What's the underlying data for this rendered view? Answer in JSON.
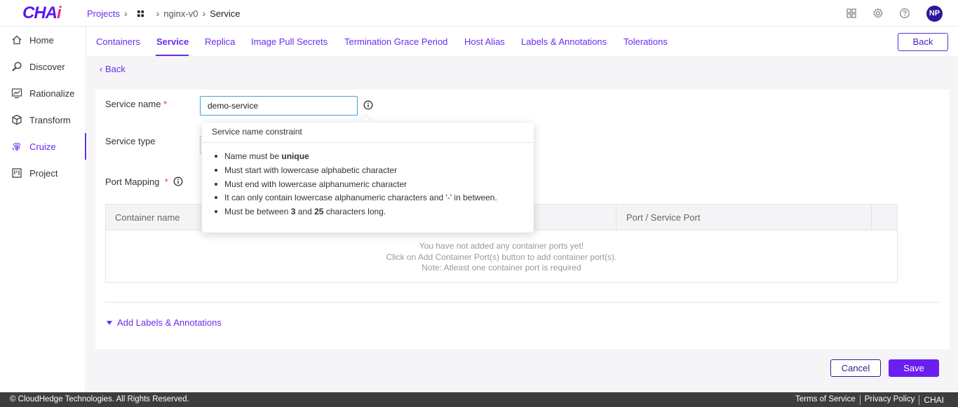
{
  "brand": {
    "logo_main": "CHA",
    "logo_accent": "i"
  },
  "breadcrumb": {
    "projects": "Projects",
    "project": "nginx-v0",
    "current": "Service"
  },
  "header": {
    "avatar": "NP"
  },
  "sidebar": {
    "items": [
      {
        "label": "Home",
        "icon": "home-icon"
      },
      {
        "label": "Discover",
        "icon": "search-icon"
      },
      {
        "label": "Rationalize",
        "icon": "chart-icon"
      },
      {
        "label": "Transform",
        "icon": "cube-icon"
      },
      {
        "label": "Cruize",
        "icon": "fingerprint-icon"
      },
      {
        "label": "Project",
        "icon": "board-icon"
      }
    ],
    "active": "Cruize"
  },
  "tabs": [
    {
      "label": "Containers"
    },
    {
      "label": "Service"
    },
    {
      "label": "Replica"
    },
    {
      "label": "Image Pull Secrets"
    },
    {
      "label": "Termination Grace Period"
    },
    {
      "label": "Host Alias"
    },
    {
      "label": "Labels & Annotations"
    },
    {
      "label": "Tolerations"
    }
  ],
  "active_tab": "Service",
  "top_back_label": "Back",
  "back_link": "Back",
  "form": {
    "service_name_label": "Service name",
    "service_name_value": "demo-service",
    "service_type_label": "Service type",
    "port_mapping_label": "Port Mapping",
    "required_mark": "*"
  },
  "table": {
    "columns": [
      "Container name",
      "Port / Service Port"
    ],
    "empty_line1": "You have not added any container ports yet!",
    "empty_line2": "Click on Add Container Port(s) button to add container port(s).",
    "empty_line3": "Note: Atleast one container port is required"
  },
  "add_labels": "Add Labels & Annotations",
  "buttons": {
    "cancel": "Cancel",
    "save": "Save"
  },
  "tooltip": {
    "title": "Service name constraint",
    "r1_pre": "Name must be ",
    "r1_bold": "unique",
    "r2": "Must start with lowercase alphabetic character",
    "r3": "Must end with lowercase alphanumeric character",
    "r4": "It can only contain lowercase alphanumeric characters and '-' in between.",
    "r5_pre": "Must be between ",
    "r5_n1": "3",
    "r5_mid": " and ",
    "r5_n2": "25",
    "r5_post": " characters long."
  },
  "footer": {
    "copyright": "© CloudHedge Technologies. All Rights Reserved.",
    "terms": "Terms of Service",
    "privacy": "Privacy Policy",
    "brand": "CHAI"
  },
  "colors": {
    "accent": "#6a2cf0",
    "footer": "#3d3d3d",
    "logo_accent": "#e8317a"
  }
}
